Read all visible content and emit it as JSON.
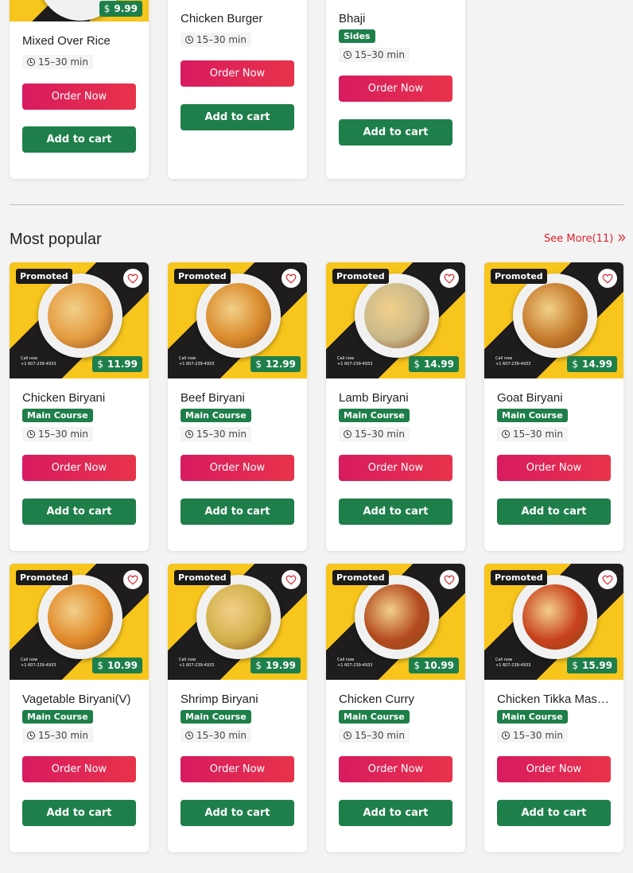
{
  "top_row": [
    {
      "name": "Mixed Over Rice",
      "price": "9.99",
      "time": "15–30 min",
      "category": ""
    },
    {
      "name": "Chicken Burger",
      "time": "15–30 min",
      "category": ""
    },
    {
      "name": "Bhaji",
      "time": "15–30 min",
      "category": "Sides"
    }
  ],
  "buttons": {
    "order": "Order Now",
    "cart": "Add to cart"
  },
  "section": {
    "title": "Most popular",
    "see_more": "See More(11)"
  },
  "badge": "Promoted",
  "currency_icon": "$",
  "callnow": [
    "Call now",
    "+1 607-239-4933"
  ],
  "popular": [
    {
      "name": "Chicken Biryani",
      "price": "11.99",
      "category": "Main Course",
      "time": "15–30 min",
      "food_color": "#e39a3f"
    },
    {
      "name": "Beef Biryani",
      "price": "12.99",
      "category": "Main Course",
      "time": "15–30 min",
      "food_color": "#d98a2b"
    },
    {
      "name": "Lamb Biryani",
      "price": "14.99",
      "category": "Main Course",
      "time": "15–30 min",
      "food_color": "#c9b98a"
    },
    {
      "name": "Goat Biryani",
      "price": "14.99",
      "category": "Main Course",
      "time": "15–30 min",
      "food_color": "#c47a2b"
    },
    {
      "name": "Vagetable Biryani(V)",
      "price": "10.99",
      "category": "Main Course",
      "time": "15–30 min",
      "food_color": "#e08a2a"
    },
    {
      "name": "Shrimp Biryani",
      "price": "19.99",
      "category": "Main Course",
      "time": "15–30 min",
      "food_color": "#d1b04a"
    },
    {
      "name": "Chicken Curry",
      "price": "10.99",
      "category": "Main Course",
      "time": "15–30 min",
      "food_color": "#b34a1f"
    },
    {
      "name": "Chicken Tikka Mas…",
      "price": "15.99",
      "category": "Main Course",
      "time": "15–30 min",
      "food_color": "#c8401c"
    }
  ]
}
